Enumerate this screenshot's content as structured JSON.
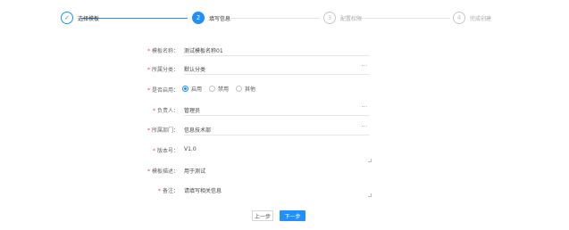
{
  "steps": [
    {
      "label": "选择模板",
      "number": "✓",
      "status": "done"
    },
    {
      "label": "填写信息",
      "number": "2",
      "status": "active"
    },
    {
      "label": "配置权限",
      "number": "3",
      "status": "wait"
    },
    {
      "label": "完成创建",
      "number": "4",
      "status": "wait"
    }
  ],
  "form": {
    "name": {
      "label": "模板名称",
      "value": "测试模板名称01",
      "required": true
    },
    "category": {
      "label": "所属分类",
      "value": "默认分类",
      "required": true
    },
    "enabled": {
      "label": "是否启用",
      "required": true,
      "options": [
        "启用",
        "禁用",
        "其他"
      ],
      "selected": "启用"
    },
    "owner": {
      "label": "负责人",
      "value": "管理员",
      "required": true
    },
    "department": {
      "label": "所属部门",
      "value": "信息技术部",
      "required": true
    },
    "version": {
      "label": "版本号",
      "value": "V1.0",
      "required": true
    },
    "description": {
      "label": "模板描述",
      "value": "用于测试",
      "required": true
    },
    "remark": {
      "label": "备注",
      "value": "请填写相关信息",
      "required": true
    }
  },
  "buttons": {
    "prev": "上一步",
    "next": "下一步"
  }
}
